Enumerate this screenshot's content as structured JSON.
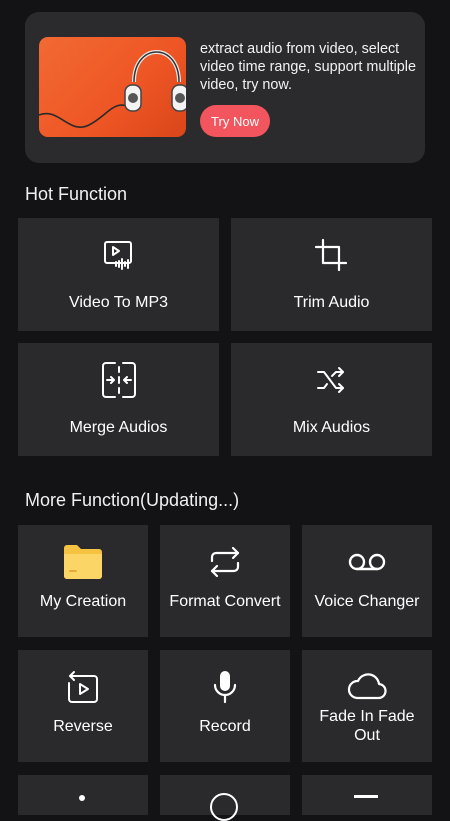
{
  "banner": {
    "description": "extract audio from video, select video time range, support multiple video, try now.",
    "button_label": "Try Now"
  },
  "hot_function": {
    "title": "Hot Function",
    "items": [
      {
        "label": "Video To MP3",
        "icon": "video-to-mp3-icon"
      },
      {
        "label": "Trim Audio",
        "icon": "crop-icon"
      },
      {
        "label": "Merge Audios",
        "icon": "merge-icon"
      },
      {
        "label": "Mix Audios",
        "icon": "shuffle-icon"
      }
    ]
  },
  "more_function": {
    "title": "More Function(Updating...)",
    "items": [
      {
        "label": "My Creation",
        "icon": "folder-icon"
      },
      {
        "label": "Format Convert",
        "icon": "repeat-icon"
      },
      {
        "label": "Voice Changer",
        "icon": "voicemail-icon"
      },
      {
        "label": "Reverse",
        "icon": "reverse-icon"
      },
      {
        "label": "Record",
        "icon": "microphone-icon"
      },
      {
        "label": "Fade In Fade Out",
        "icon": "cloud-icon"
      }
    ]
  },
  "colors": {
    "background": "#131316",
    "card": "#2a2a2c",
    "accent_button": "#f2555d",
    "folder": "#f5c242"
  }
}
